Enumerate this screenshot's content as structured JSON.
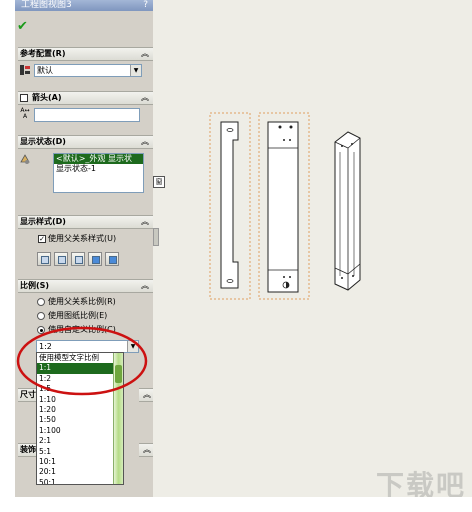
{
  "property_manager": {
    "title": "工程图视图3",
    "help_glyph": "?",
    "confirm_glyph": "✔"
  },
  "sections": {
    "reference_config": {
      "title": "参考配置(R)",
      "value": "默认"
    },
    "arrow": {
      "title": "箭头(A)",
      "input_value": ""
    },
    "display_state": {
      "title": "显示状态(D)",
      "items": [
        "<默认>_外观 显示状",
        "显示状态-1"
      ]
    },
    "display_style": {
      "title": "显示样式(D)",
      "use_parent_label": "使用父关系样式(U)"
    },
    "scale": {
      "title": "比例(S)",
      "options": [
        "使用父关系比例(R)",
        "使用图纸比例(E)",
        "使用自定义比例(C)"
      ],
      "selected_option": 2,
      "current_value": "1:2",
      "dropdown_items": [
        "使用模型文字比例",
        "1:1",
        "1:2",
        "1:5",
        "1:10",
        "1:20",
        "1:50",
        "1:100",
        "2:1",
        "5:1",
        "10:1",
        "20:1",
        "50:1"
      ],
      "dropdown_selected": 1
    },
    "partial_labels": [
      "尺寸",
      "装饰"
    ]
  },
  "canvas": {
    "side_tab_glyph": "窗"
  },
  "watermark": {
    "text": "下载吧"
  },
  "colors": {
    "panel_bg": "#d4d0c8",
    "canvas_bg": "#eeede6",
    "selection": "#1d6a1d",
    "accent_green": "#b5dc86",
    "annotation_red": "#cc1111",
    "view_border": "#e0a060"
  }
}
